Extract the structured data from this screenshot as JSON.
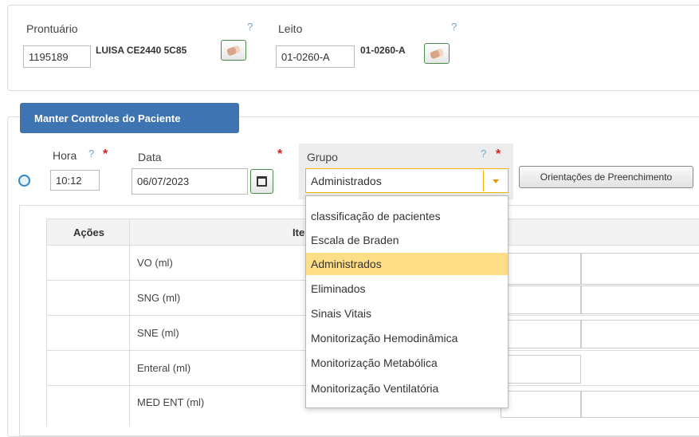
{
  "header": {
    "prontuario_label": "Prontuário",
    "prontuario_value": "1195189",
    "patient_name": "LUISA CE2440 5C85",
    "leito_label": "Leito",
    "leito_value": "01-0260-A",
    "leito_display": "01-0260-A",
    "help_glyph": "?"
  },
  "controls": {
    "tab_title": "Manter Controles do Paciente",
    "hora_label": "Hora",
    "hora_value": "10:12",
    "data_label": "Data",
    "data_value": "06/07/2023",
    "grupo_label": "Grupo",
    "grupo_value": "Administrados",
    "orientacoes_button": "Orientações de Preenchimento",
    "required_glyph": "*"
  },
  "table": {
    "col_acoes": "Ações",
    "col_itens": "Itens",
    "rows": [
      "VO (ml)",
      "SNG (ml)",
      "SNE (ml)",
      "Enteral (ml)",
      "MED ENT (ml)"
    ]
  },
  "dropdown": {
    "selected_index": 2,
    "options": [
      "classificação de pacientes",
      "Escala de Braden",
      "Administrados",
      "Eliminados",
      "Sinais Vitais",
      "Monitorização Hemodinâmica",
      "Monitorização Metabólica",
      "Monitorização Ventilatória"
    ]
  },
  "colors": {
    "tab_blue": "#3f74b3",
    "selected_bg": "#fddd85",
    "required_red": "#d42020",
    "help_blue": "#6aa7d6"
  }
}
